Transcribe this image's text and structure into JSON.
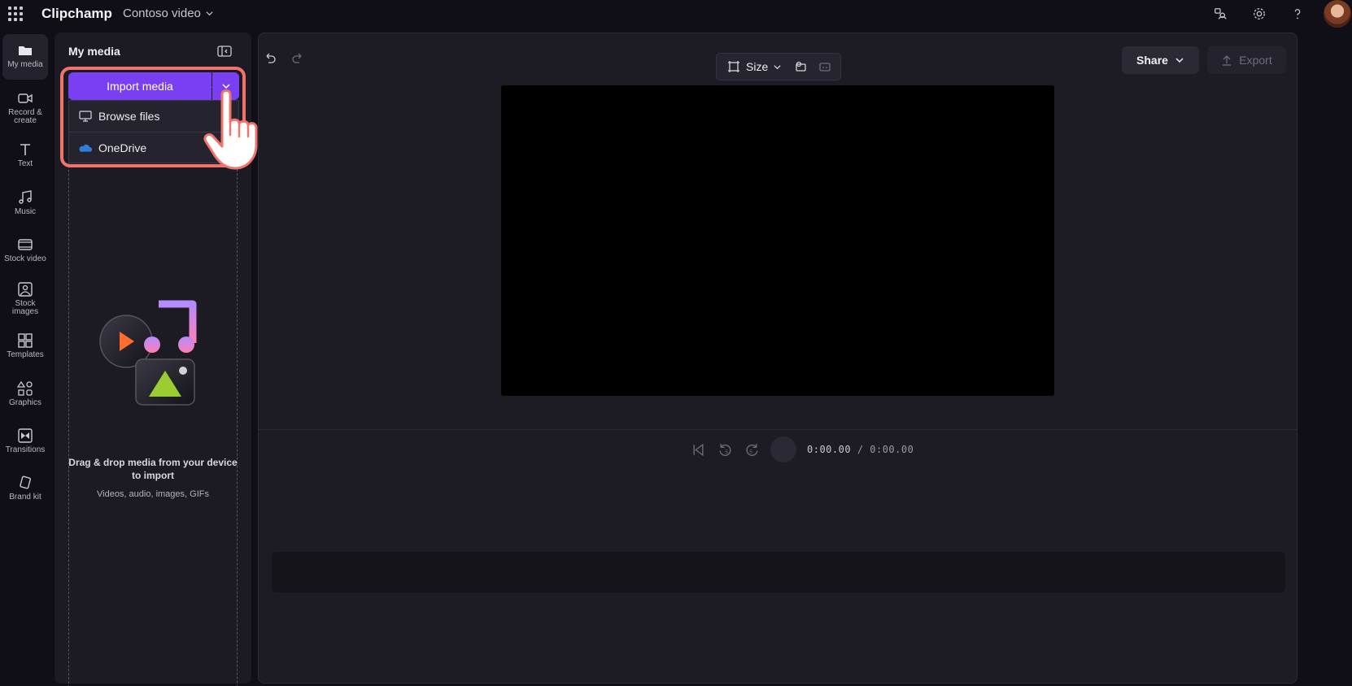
{
  "app": {
    "name": "Clipchamp",
    "project_name": "Contoso video"
  },
  "rail": {
    "items": [
      {
        "label": "My media",
        "icon": "folder-icon",
        "active": true
      },
      {
        "label": "Record & create",
        "icon": "camera-icon"
      },
      {
        "label": "Text",
        "icon": "text-icon"
      },
      {
        "label": "Music",
        "icon": "music-icon"
      },
      {
        "label": "Stock video",
        "icon": "film-icon"
      },
      {
        "label": "Stock images",
        "icon": "image-icon"
      },
      {
        "label": "Templates",
        "icon": "templates-icon"
      },
      {
        "label": "Graphics",
        "icon": "shapes-icon"
      },
      {
        "label": "Transitions",
        "icon": "transitions-icon"
      },
      {
        "label": "Brand kit",
        "icon": "brand-icon"
      }
    ]
  },
  "media_panel": {
    "title": "My media",
    "import_label": "Import media",
    "menu": [
      {
        "label": "Browse files",
        "icon": "monitor-icon"
      },
      {
        "label": "OneDrive",
        "icon": "onedrive-icon"
      }
    ],
    "drop_text": "Drag & drop media from your device to import",
    "drop_subtext": "Videos, audio, images, GIFs"
  },
  "editor": {
    "size_label": "Size",
    "share_label": "Share",
    "export_label": "Export",
    "time_current": "0:00.00",
    "time_total": "/ 0:00.00",
    "rewind_seconds": "5",
    "forward_seconds": "5"
  },
  "colors": {
    "accent": "#7a3ff2",
    "highlight": "#f2736a",
    "background": "#100f17"
  }
}
